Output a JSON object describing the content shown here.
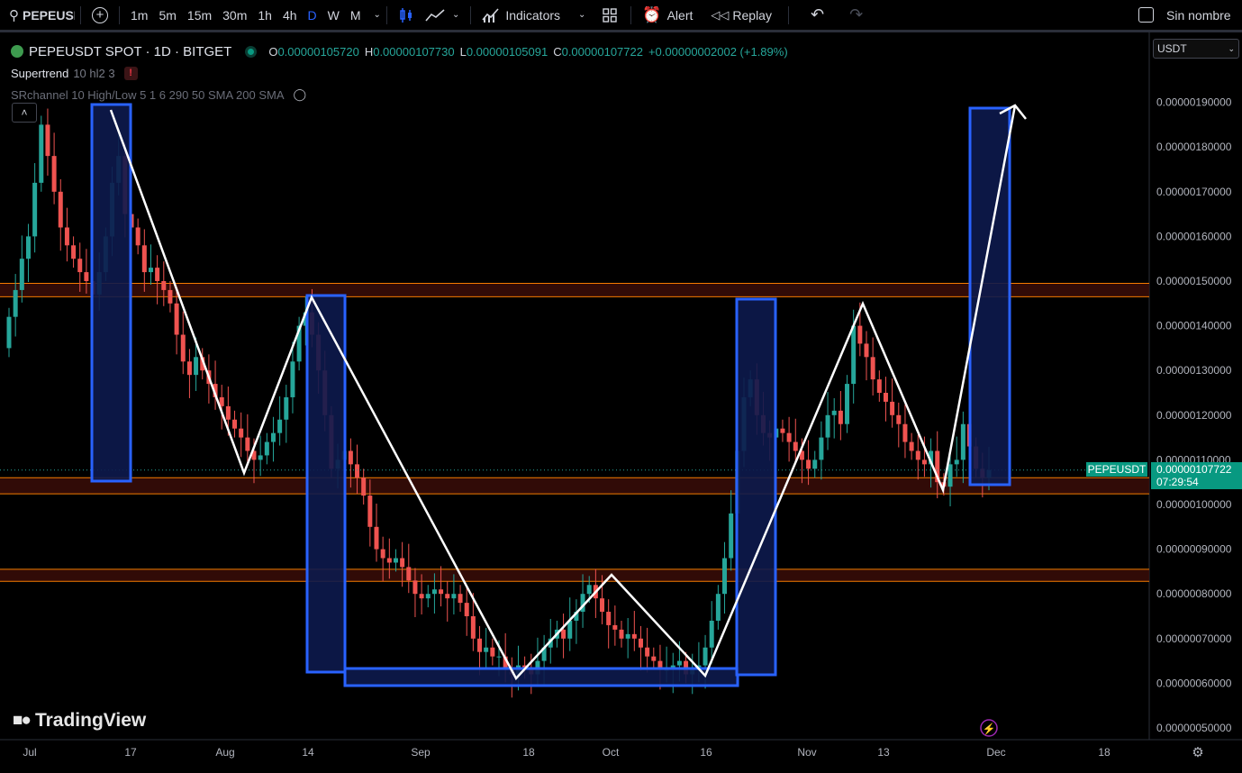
{
  "toolbar": {
    "symbol": "PEPEUSDT",
    "intervals": [
      "1m",
      "5m",
      "15m",
      "30m",
      "1h",
      "4h",
      "D",
      "W",
      "M"
    ],
    "active_interval": "D",
    "indicators_label": "Indicators",
    "alert_label": "Alert",
    "replay_label": "Replay",
    "layout_name": "Sin nombre"
  },
  "legend": {
    "title": "PEPEUSDT SPOT · 1D · BITGET",
    "open_label": "O",
    "open": "0.00000105720",
    "high_label": "H",
    "high": "0.00000107730",
    "low_label": "L",
    "low": "0.00000105091",
    "close_label": "C",
    "close": "0.00000107722",
    "change": "+0.00000002002 (+1.89%)",
    "indicator1": "Supertrend",
    "indicator1_params": "10 hl2 3",
    "indicator2": "SRchannel 10 High/Low 5 1 6 290 50 SMA 200 SMA"
  },
  "currency": "USDT",
  "price_tag": {
    "symbol": "PEPEUSDT",
    "price": "0.00000107722",
    "countdown": "07:29:54"
  },
  "brand": "TradingView",
  "colors": {
    "up": "#26a69a",
    "down": "#ef5350",
    "box": "#2962ff",
    "zigzag": "#ffffff",
    "sr": "#f57c00"
  },
  "chart_data": {
    "type": "candlestick",
    "y_axis": {
      "min": 4.5e-07,
      "max": 1.95e-06,
      "scale": "linear"
    },
    "y_ticks": [
      "0.00000190000",
      "0.00000180000",
      "0.00000170000",
      "0.00000160000",
      "0.00000150000",
      "0.00000140000",
      "0.00000130000",
      "0.00000120000",
      "0.00000110000",
      "0.00000100000",
      "0.00000090000",
      "0.00000080000",
      "0.00000070000",
      "0.00000060000",
      "0.00000050000"
    ],
    "x_ticks": [
      "Jul",
      "17",
      "Aug",
      "14",
      "Sep",
      "18",
      "Oct",
      "16",
      "Nov",
      "13",
      "Dec",
      "18"
    ],
    "candles_close": [
      1.42,
      1.48,
      1.55,
      1.6,
      1.72,
      1.85,
      1.78,
      1.7,
      1.62,
      1.58,
      1.55,
      1.52,
      1.5,
      1.47,
      1.52,
      1.6,
      1.72,
      1.78,
      1.65,
      1.62,
      1.58,
      1.52,
      1.53,
      1.5,
      1.48,
      1.45,
      1.38,
      1.32,
      1.29,
      1.33,
      1.3,
      1.27,
      1.24,
      1.22,
      1.19,
      1.17,
      1.15,
      1.12,
      1.1,
      1.11,
      1.14,
      1.16,
      1.19,
      1.24,
      1.32,
      1.4,
      1.43,
      1.38,
      1.3,
      1.2,
      1.08,
      1.1,
      1.12,
      1.09,
      1.06,
      1.02,
      0.95,
      0.9,
      0.88,
      0.87,
      0.88,
      0.86,
      0.83,
      0.8,
      0.79,
      0.8,
      0.81,
      0.8,
      0.79,
      0.8,
      0.78,
      0.75,
      0.7,
      0.67,
      0.68,
      0.66,
      0.66,
      0.63,
      0.62,
      0.64,
      0.63,
      0.62,
      0.65,
      0.68,
      0.7,
      0.72,
      0.7,
      0.74,
      0.76,
      0.8,
      0.82,
      0.79,
      0.76,
      0.73,
      0.72,
      0.7,
      0.71,
      0.7,
      0.68,
      0.66,
      0.65,
      0.63,
      0.63,
      0.64,
      0.65,
      0.62,
      0.63,
      0.64,
      0.68,
      0.74,
      0.8,
      0.88,
      0.98,
      1.12,
      1.24,
      1.28,
      1.2,
      1.16,
      1.15,
      1.17,
      1.16,
      1.14,
      1.12,
      1.1,
      1.08,
      1.1,
      1.15,
      1.2,
      1.21,
      1.18,
      1.27,
      1.4,
      1.36,
      1.33,
      1.28,
      1.25,
      1.23,
      1.2,
      1.18,
      1.14,
      1.12,
      1.1,
      1.09,
      1.12,
      1.05,
      1.04,
      1.09,
      1.1,
      1.18,
      1.13,
      1.08,
      1.06,
      1.077
    ],
    "series": [
      {
        "name": "SR zone 1",
        "values": [
          1.465,
          1.495
        ]
      },
      {
        "name": "SR zone 2",
        "values": [
          1.024,
          1.06
        ]
      },
      {
        "name": "SR zone 3",
        "values": [
          0.828,
          0.855
        ]
      }
    ],
    "zigzag": [
      [
        "2023-07-14",
        1.88
      ],
      [
        "2023-08-03",
        1.1
      ],
      [
        "2023-08-14",
        1.45
      ],
      [
        "2023-09-17",
        0.62
      ],
      [
        "2023-10-01",
        0.84
      ],
      [
        "2023-10-16",
        0.62
      ],
      [
        "2023-11-08",
        1.45
      ],
      [
        "2023-11-27",
        1.03
      ],
      [
        "2023-12-01",
        1.89
      ]
    ],
    "unit_note": "prices x 1e-6"
  }
}
